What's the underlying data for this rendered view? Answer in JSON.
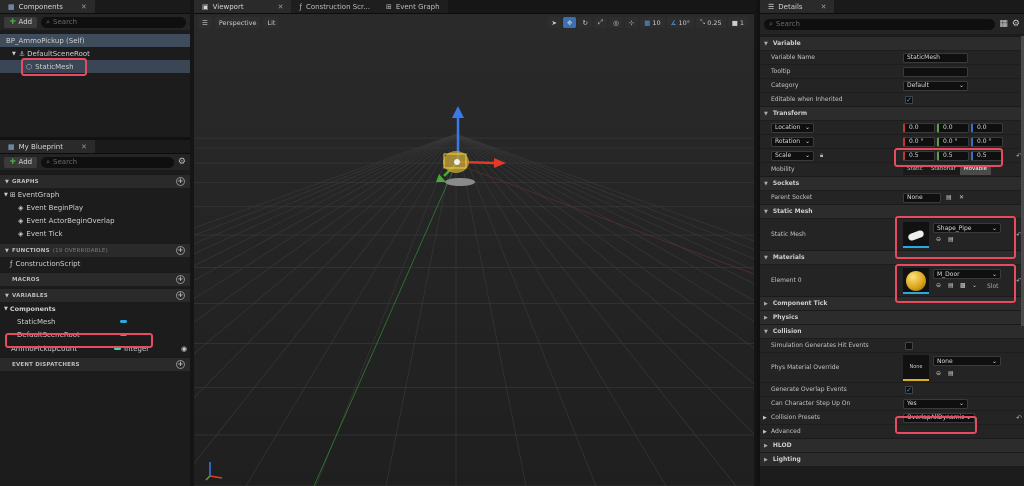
{
  "components": {
    "tab_label": "Components",
    "add_label": "Add",
    "search_placeholder": "Search",
    "tree": [
      "BP_AmmoPickup (Self)",
      "DefaultSceneRoot",
      "StaticMesh"
    ]
  },
  "my_blueprint": {
    "tab_label": "My Blueprint",
    "add_label": "Add",
    "search_placeholder": "Search",
    "sections": {
      "graphs": "GRAPHS",
      "functions": "FUNCTIONS",
      "functions_count": "(19 OVERRIDABLE)",
      "macros": "MACROS",
      "variables": "VARIABLES",
      "event_dispatchers": "EVENT DISPATCHERS"
    },
    "graphs": [
      "EventGraph",
      "Event BeginPlay",
      "Event ActorBeginOverlap",
      "Event Tick"
    ],
    "functions": [
      "ConstructionScript"
    ],
    "components_group": "Components",
    "component_vars": [
      "StaticMesh",
      "DefaultSceneRoot"
    ],
    "variable": {
      "name": "AmmoPickupCount",
      "type": "Integer"
    }
  },
  "editor_tabs": [
    "Viewport",
    "Construction Scr...",
    "Event Graph"
  ],
  "viewport": {
    "perspective": "Perspective",
    "lit": "Lit",
    "grid_snap": "10",
    "rot_snap": "10°",
    "scale_snap": "0.25",
    "cam_speed": "1"
  },
  "details": {
    "tab_label": "Details",
    "search_placeholder": "Search",
    "variable_section": "Variable",
    "variable_name_label": "Variable Name",
    "variable_name_value": "StaticMesh",
    "tooltip_label": "Tooltip",
    "category_label": "Category",
    "category_value": "Default",
    "editable_label": "Editable when Inherited",
    "transform_section": "Transform",
    "location_label": "Location",
    "rotation_label": "Rotation",
    "scale_label": "Scale",
    "location": [
      "0.0",
      "0.0",
      "0.0"
    ],
    "rotation": [
      "0.0 °",
      "0.0 °",
      "0.0 °"
    ],
    "scale": [
      "0.5",
      "0.5",
      "0.5"
    ],
    "mobility_label": "Mobility",
    "mobility_options": [
      "Static",
      "Stationar",
      "Movable"
    ],
    "sockets_section": "Sockets",
    "parent_socket_label": "Parent Socket",
    "parent_socket_value": "None",
    "static_mesh_section": "Static Mesh",
    "static_mesh_label": "Static Mesh",
    "static_mesh_value": "Shape_Pipe",
    "materials_section": "Materials",
    "element0_label": "Element 0",
    "material_value": "M_Door",
    "slot_label": "Slot",
    "component_tick_section": "Component Tick",
    "physics_section": "Physics",
    "collision_section": "Collision",
    "sim_hit_label": "Simulation Generates Hit Events",
    "phys_mat_label": "Phys Material Override",
    "phys_mat_value": "None",
    "phys_mat_thumb": "None",
    "gen_overlap_label": "Generate Overlap Events",
    "step_up_label": "Can Character Step Up On",
    "step_up_value": "Yes",
    "presets_label": "Collision Presets",
    "presets_value": "OverlapAllDynamic",
    "advanced_section": "Advanced",
    "hlod_section": "HLOD",
    "lighting_section": "Lighting"
  },
  "colors": {
    "highlight": "#e84a5f",
    "selection": "#3f4c5c",
    "accent": "#2aa8e0"
  }
}
